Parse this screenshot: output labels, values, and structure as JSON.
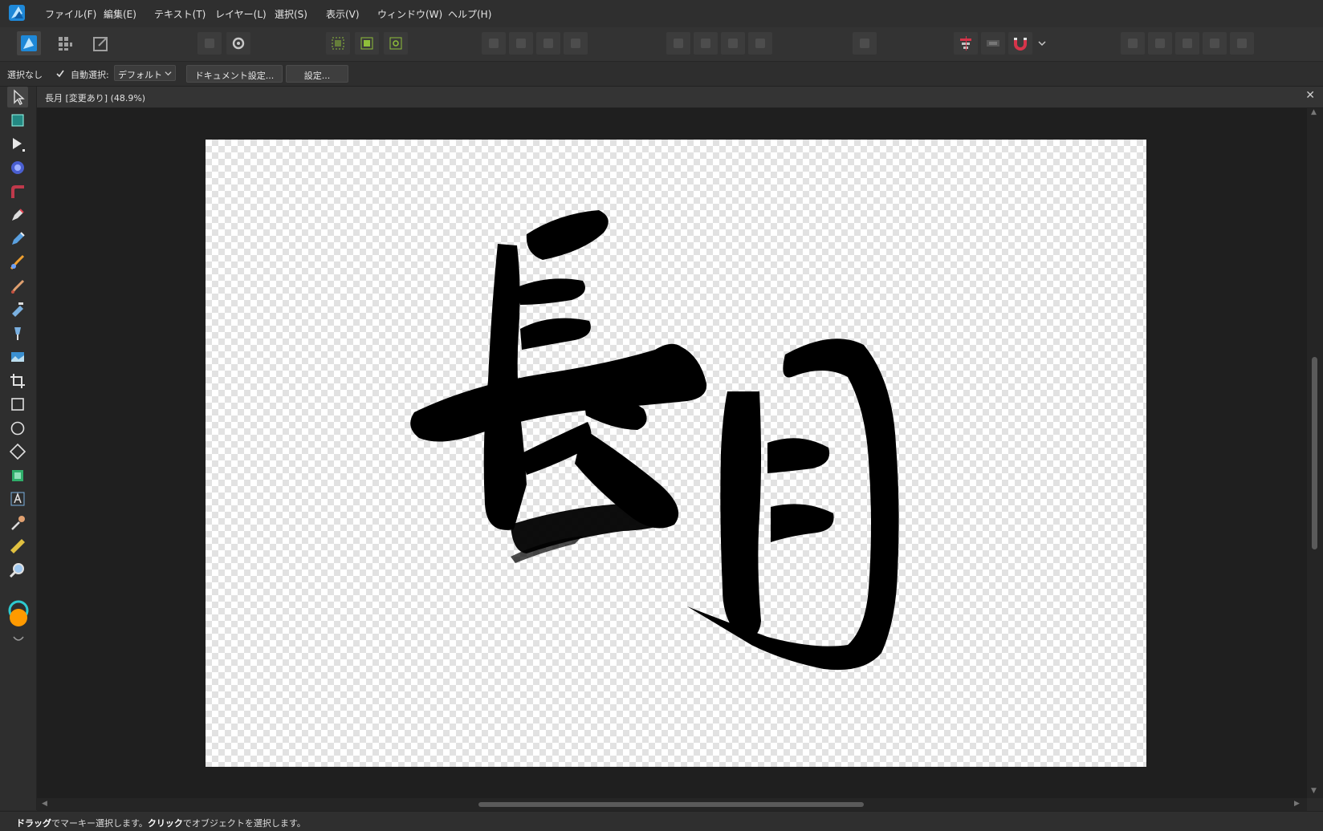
{
  "menu": [
    "ファイル(F)",
    "編集(E)",
    "テキスト(T)",
    "レイヤー(L)",
    "選択(S)",
    "表示(V)",
    "ウィンドウ(W)",
    "ヘルプ(H)"
  ],
  "context": {
    "selection": "選択なし",
    "auto_select_label": "自動選択:",
    "auto_select_value": "デフォルト",
    "document_setup": "ドキュメント設定...",
    "preferences": "設定..."
  },
  "document": {
    "title": "長月 [変更あり] (48.9%)"
  },
  "status": {
    "drag": "ドラッグ",
    "drag_text": "でマーキー選択します。",
    "click": "クリック",
    "click_text": "でオブジェクトを選択します。"
  },
  "colors": {
    "accent": "#1e88d8",
    "snap": "#d6344a",
    "primary_swatch": "#ff9a00",
    "secondary_swatch": "#2dc9cf"
  }
}
